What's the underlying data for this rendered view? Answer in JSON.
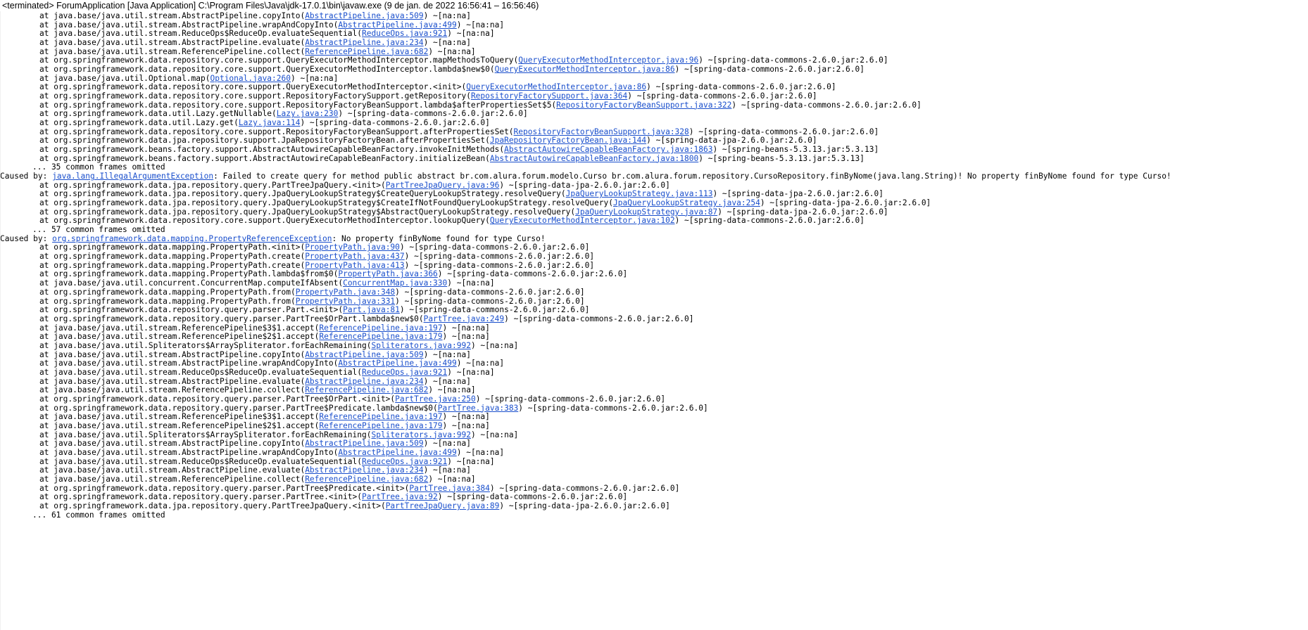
{
  "console": {
    "header": "<terminated> ForumApplication [Java Application] C:\\Program Files\\Java\\jdk-17.0.1\\bin\\javaw.exe  (9 de jan. de 2022 16:56:41 – 16:56:46)",
    "terminated_marker": "<terminated>",
    "launch_config": "ForumApplication",
    "launch_type": "Java Application",
    "jvm_path": "C:\\Program Files\\Java\\jdk-17.0.1\\bin\\javaw.exe",
    "run_timestamp": "(9 de jan. de 2022 16:56:41 – 16:56:46)",
    "link_color": "#1a4fcc",
    "text_color": "#000000",
    "background_color": "#ffffff"
  },
  "lines": [
    {
      "kind": "at",
      "pre": "at java.base/java.util.stream.AbstractPipeline.copyInto(",
      "link": "AbstractPipeline.java:509",
      "post": ") ~[na:na]"
    },
    {
      "kind": "at",
      "pre": "at java.base/java.util.stream.AbstractPipeline.wrapAndCopyInto(",
      "link": "AbstractPipeline.java:499",
      "post": ") ~[na:na]"
    },
    {
      "kind": "at",
      "pre": "at java.base/java.util.stream.ReduceOps$ReduceOp.evaluateSequential(",
      "link": "ReduceOps.java:921",
      "post": ") ~[na:na]"
    },
    {
      "kind": "at",
      "pre": "at java.base/java.util.stream.AbstractPipeline.evaluate(",
      "link": "AbstractPipeline.java:234",
      "post": ") ~[na:na]"
    },
    {
      "kind": "at",
      "pre": "at java.base/java.util.stream.ReferencePipeline.collect(",
      "link": "ReferencePipeline.java:682",
      "post": ") ~[na:na]"
    },
    {
      "kind": "at",
      "pre": "at org.springframework.data.repository.core.support.QueryExecutorMethodInterceptor.mapMethodsToQuery(",
      "link": "QueryExecutorMethodInterceptor.java:96",
      "post": ") ~[spring-data-commons-2.6.0.jar:2.6.0]"
    },
    {
      "kind": "at",
      "pre": "at org.springframework.data.repository.core.support.QueryExecutorMethodInterceptor.lambda$new$0(",
      "link": "QueryExecutorMethodInterceptor.java:86",
      "post": ") ~[spring-data-commons-2.6.0.jar:2.6.0]"
    },
    {
      "kind": "at",
      "pre": "at java.base/java.util.Optional.map(",
      "link": "Optional.java:260",
      "post": ") ~[na:na]"
    },
    {
      "kind": "at",
      "pre": "at org.springframework.data.repository.core.support.QueryExecutorMethodInterceptor.<init>(",
      "link": "QueryExecutorMethodInterceptor.java:86",
      "post": ") ~[spring-data-commons-2.6.0.jar:2.6.0]"
    },
    {
      "kind": "at",
      "pre": "at org.springframework.data.repository.core.support.RepositoryFactorySupport.getRepository(",
      "link": "RepositoryFactorySupport.java:364",
      "post": ") ~[spring-data-commons-2.6.0.jar:2.6.0]"
    },
    {
      "kind": "at",
      "pre": "at org.springframework.data.repository.core.support.RepositoryFactoryBeanSupport.lambda$afterPropertiesSet$5(",
      "link": "RepositoryFactoryBeanSupport.java:322",
      "post": ") ~[spring-data-commons-2.6.0.jar:2.6.0]"
    },
    {
      "kind": "at",
      "pre": "at org.springframework.data.util.Lazy.getNullable(",
      "link": "Lazy.java:230",
      "post": ") ~[spring-data-commons-2.6.0.jar:2.6.0]"
    },
    {
      "kind": "at",
      "pre": "at org.springframework.data.util.Lazy.get(",
      "link": "Lazy.java:114",
      "post": ") ~[spring-data-commons-2.6.0.jar:2.6.0]"
    },
    {
      "kind": "at",
      "pre": "at org.springframework.data.repository.core.support.RepositoryFactoryBeanSupport.afterPropertiesSet(",
      "link": "RepositoryFactoryBeanSupport.java:328",
      "post": ") ~[spring-data-commons-2.6.0.jar:2.6.0]"
    },
    {
      "kind": "at",
      "pre": "at org.springframework.data.jpa.repository.support.JpaRepositoryFactoryBean.afterPropertiesSet(",
      "link": "JpaRepositoryFactoryBean.java:144",
      "post": ") ~[spring-data-jpa-2.6.0.jar:2.6.0]"
    },
    {
      "kind": "at",
      "pre": "at org.springframework.beans.factory.support.AbstractAutowireCapableBeanFactory.invokeInitMethods(",
      "link": "AbstractAutowireCapableBeanFactory.java:1863",
      "post": ") ~[spring-beans-5.3.13.jar:5.3.13]"
    },
    {
      "kind": "at",
      "pre": "at org.springframework.beans.factory.support.AbstractAutowireCapableBeanFactory.initializeBean(",
      "link": "AbstractAutowireCapableBeanFactory.java:1800",
      "post": ") ~[spring-beans-5.3.13.jar:5.3.13]"
    },
    {
      "kind": "omitted",
      "pre": "... 35 common frames omitted",
      "link": "",
      "post": ""
    },
    {
      "kind": "caused",
      "pre": "Caused by: ",
      "link": "java.lang.IllegalArgumentException",
      "post": ": Failed to create query for method public abstract br.com.alura.forum.modelo.Curso br.com.alura.forum.repository.CursoRepository.finByNome(java.lang.String)! No property finByNome found for type Curso!"
    },
    {
      "kind": "at",
      "pre": "at org.springframework.data.jpa.repository.query.PartTreeJpaQuery.<init>(",
      "link": "PartTreeJpaQuery.java:96",
      "post": ") ~[spring-data-jpa-2.6.0.jar:2.6.0]"
    },
    {
      "kind": "at",
      "pre": "at org.springframework.data.jpa.repository.query.JpaQueryLookupStrategy$CreateQueryLookupStrategy.resolveQuery(",
      "link": "JpaQueryLookupStrategy.java:113",
      "post": ") ~[spring-data-jpa-2.6.0.jar:2.6.0]"
    },
    {
      "kind": "at",
      "pre": "at org.springframework.data.jpa.repository.query.JpaQueryLookupStrategy$CreateIfNotFoundQueryLookupStrategy.resolveQuery(",
      "link": "JpaQueryLookupStrategy.java:254",
      "post": ") ~[spring-data-jpa-2.6.0.jar:2.6.0]"
    },
    {
      "kind": "at",
      "pre": "at org.springframework.data.jpa.repository.query.JpaQueryLookupStrategy$AbstractQueryLookupStrategy.resolveQuery(",
      "link": "JpaQueryLookupStrategy.java:87",
      "post": ") ~[spring-data-jpa-2.6.0.jar:2.6.0]"
    },
    {
      "kind": "at",
      "pre": "at org.springframework.data.repository.core.support.QueryExecutorMethodInterceptor.lookupQuery(",
      "link": "QueryExecutorMethodInterceptor.java:102",
      "post": ") ~[spring-data-commons-2.6.0.jar:2.6.0]"
    },
    {
      "kind": "omitted",
      "pre": "... 57 common frames omitted",
      "link": "",
      "post": ""
    },
    {
      "kind": "caused",
      "pre": "Caused by: ",
      "link": "org.springframework.data.mapping.PropertyReferenceException",
      "post": ": No property finByNome found for type Curso!"
    },
    {
      "kind": "at",
      "pre": "at org.springframework.data.mapping.PropertyPath.<init>(",
      "link": "PropertyPath.java:90",
      "post": ") ~[spring-data-commons-2.6.0.jar:2.6.0]"
    },
    {
      "kind": "at",
      "pre": "at org.springframework.data.mapping.PropertyPath.create(",
      "link": "PropertyPath.java:437",
      "post": ") ~[spring-data-commons-2.6.0.jar:2.6.0]"
    },
    {
      "kind": "at",
      "pre": "at org.springframework.data.mapping.PropertyPath.create(",
      "link": "PropertyPath.java:413",
      "post": ") ~[spring-data-commons-2.6.0.jar:2.6.0]"
    },
    {
      "kind": "at",
      "pre": "at org.springframework.data.mapping.PropertyPath.lambda$from$0(",
      "link": "PropertyPath.java:366",
      "post": ") ~[spring-data-commons-2.6.0.jar:2.6.0]"
    },
    {
      "kind": "at",
      "pre": "at java.base/java.util.concurrent.ConcurrentMap.computeIfAbsent(",
      "link": "ConcurrentMap.java:330",
      "post": ") ~[na:na]"
    },
    {
      "kind": "at",
      "pre": "at org.springframework.data.mapping.PropertyPath.from(",
      "link": "PropertyPath.java:348",
      "post": ") ~[spring-data-commons-2.6.0.jar:2.6.0]"
    },
    {
      "kind": "at",
      "pre": "at org.springframework.data.mapping.PropertyPath.from(",
      "link": "PropertyPath.java:331",
      "post": ") ~[spring-data-commons-2.6.0.jar:2.6.0]"
    },
    {
      "kind": "at",
      "pre": "at org.springframework.data.repository.query.parser.Part.<init>(",
      "link": "Part.java:81",
      "post": ") ~[spring-data-commons-2.6.0.jar:2.6.0]"
    },
    {
      "kind": "at",
      "pre": "at org.springframework.data.repository.query.parser.PartTree$OrPart.lambda$new$0(",
      "link": "PartTree.java:249",
      "post": ") ~[spring-data-commons-2.6.0.jar:2.6.0]"
    },
    {
      "kind": "at",
      "pre": "at java.base/java.util.stream.ReferencePipeline$3$1.accept(",
      "link": "ReferencePipeline.java:197",
      "post": ") ~[na:na]"
    },
    {
      "kind": "at",
      "pre": "at java.base/java.util.stream.ReferencePipeline$2$1.accept(",
      "link": "ReferencePipeline.java:179",
      "post": ") ~[na:na]"
    },
    {
      "kind": "at",
      "pre": "at java.base/java.util.Spliterators$ArraySpliterator.forEachRemaining(",
      "link": "Spliterators.java:992",
      "post": ") ~[na:na]"
    },
    {
      "kind": "at",
      "pre": "at java.base/java.util.stream.AbstractPipeline.copyInto(",
      "link": "AbstractPipeline.java:509",
      "post": ") ~[na:na]"
    },
    {
      "kind": "at",
      "pre": "at java.base/java.util.stream.AbstractPipeline.wrapAndCopyInto(",
      "link": "AbstractPipeline.java:499",
      "post": ") ~[na:na]"
    },
    {
      "kind": "at",
      "pre": "at java.base/java.util.stream.ReduceOps$ReduceOp.evaluateSequential(",
      "link": "ReduceOps.java:921",
      "post": ") ~[na:na]"
    },
    {
      "kind": "at",
      "pre": "at java.base/java.util.stream.AbstractPipeline.evaluate(",
      "link": "AbstractPipeline.java:234",
      "post": ") ~[na:na]"
    },
    {
      "kind": "at",
      "pre": "at java.base/java.util.stream.ReferencePipeline.collect(",
      "link": "ReferencePipeline.java:682",
      "post": ") ~[na:na]"
    },
    {
      "kind": "at",
      "pre": "at org.springframework.data.repository.query.parser.PartTree$OrPart.<init>(",
      "link": "PartTree.java:250",
      "post": ") ~[spring-data-commons-2.6.0.jar:2.6.0]"
    },
    {
      "kind": "at",
      "pre": "at org.springframework.data.repository.query.parser.PartTree$Predicate.lambda$new$0(",
      "link": "PartTree.java:383",
      "post": ") ~[spring-data-commons-2.6.0.jar:2.6.0]"
    },
    {
      "kind": "at",
      "pre": "at java.base/java.util.stream.ReferencePipeline$3$1.accept(",
      "link": "ReferencePipeline.java:197",
      "post": ") ~[na:na]"
    },
    {
      "kind": "at",
      "pre": "at java.base/java.util.stream.ReferencePipeline$2$1.accept(",
      "link": "ReferencePipeline.java:179",
      "post": ") ~[na:na]"
    },
    {
      "kind": "at",
      "pre": "at java.base/java.util.Spliterators$ArraySpliterator.forEachRemaining(",
      "link": "Spliterators.java:992",
      "post": ") ~[na:na]"
    },
    {
      "kind": "at",
      "pre": "at java.base/java.util.stream.AbstractPipeline.copyInto(",
      "link": "AbstractPipeline.java:509",
      "post": ") ~[na:na]"
    },
    {
      "kind": "at",
      "pre": "at java.base/java.util.stream.AbstractPipeline.wrapAndCopyInto(",
      "link": "AbstractPipeline.java:499",
      "post": ") ~[na:na]"
    },
    {
      "kind": "at",
      "pre": "at java.base/java.util.stream.ReduceOps$ReduceOp.evaluateSequential(",
      "link": "ReduceOps.java:921",
      "post": ") ~[na:na]"
    },
    {
      "kind": "at",
      "pre": "at java.base/java.util.stream.AbstractPipeline.evaluate(",
      "link": "AbstractPipeline.java:234",
      "post": ") ~[na:na]"
    },
    {
      "kind": "at",
      "pre": "at java.base/java.util.stream.ReferencePipeline.collect(",
      "link": "ReferencePipeline.java:682",
      "post": ") ~[na:na]"
    },
    {
      "kind": "at",
      "pre": "at org.springframework.data.repository.query.parser.PartTree$Predicate.<init>(",
      "link": "PartTree.java:384",
      "post": ") ~[spring-data-commons-2.6.0.jar:2.6.0]"
    },
    {
      "kind": "at",
      "pre": "at org.springframework.data.repository.query.parser.PartTree.<init>(",
      "link": "PartTree.java:92",
      "post": ") ~[spring-data-commons-2.6.0.jar:2.6.0]"
    },
    {
      "kind": "at",
      "pre": "at org.springframework.data.jpa.repository.query.PartTreeJpaQuery.<init>(",
      "link": "PartTreeJpaQuery.java:89",
      "post": ") ~[spring-data-jpa-2.6.0.jar:2.6.0]"
    },
    {
      "kind": "omitted",
      "pre": "... 61 common frames omitted",
      "link": "",
      "post": ""
    }
  ]
}
